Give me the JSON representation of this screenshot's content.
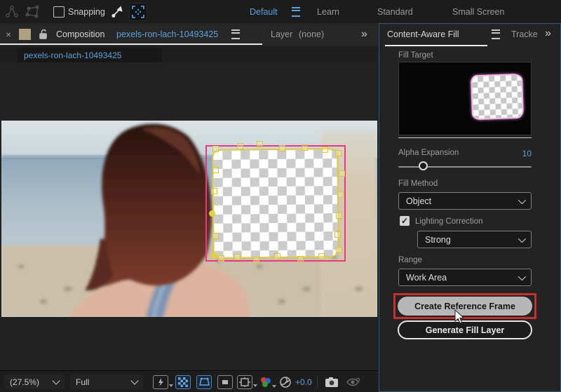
{
  "colors": {
    "accent_blue": "#5ea1da",
    "mask_pink": "#ea3a7e",
    "mask_yellow": "#dcc74a",
    "annotation_red": "#c4302b",
    "active_icon_blue": "#6da0d4",
    "swatch_tan": "#b0a083"
  },
  "top_toolbar": {
    "snapping_label": "Snapping",
    "workspaces": {
      "active": "Default",
      "others": [
        "Learn",
        "Standard",
        "Small Screen"
      ]
    }
  },
  "viewer_header": {
    "close_glyph": "×",
    "composition_label": "Composition",
    "composition_name": "pexels-ron-lach-10493425",
    "menu_glyph": "",
    "layer_label": "Layer",
    "layer_value": "(none)",
    "overflow_glyph": "»",
    "viewer_selector_value": "pexels-ron-lach-10493425"
  },
  "caf_panel": {
    "tab_title": "Content-Aware Fill",
    "neighbor_tab": "Tracke",
    "overflow_glyph": "»",
    "fill_target_label": "Fill Target",
    "alpha_expansion_label": "Alpha Expansion",
    "alpha_expansion_value": "10",
    "fill_method_label": "Fill Method",
    "fill_method_value": "Object",
    "lighting_correction_label": "Lighting Correction",
    "lighting_correction_checked": true,
    "lighting_correction_value": "Strong",
    "range_label": "Range",
    "range_value": "Work Area",
    "create_reference_button": "Create Reference Frame",
    "generate_fill_button": "Generate Fill Layer"
  },
  "bottom_bar": {
    "zoom_value": "(27.5%)",
    "resolution_value": "Full",
    "exposure_value": "+0.0"
  }
}
